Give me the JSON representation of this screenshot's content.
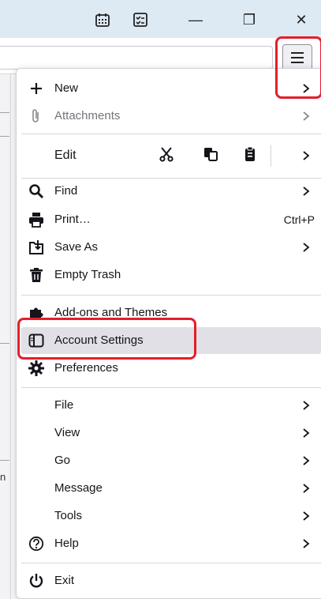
{
  "window": {
    "minimize_glyph": "—",
    "restore_glyph": "❐",
    "close_glyph": "✕",
    "icons": [
      "calendar-icon",
      "tasks-icon"
    ]
  },
  "background": {
    "partial_char": "n"
  },
  "colors": {
    "titlebar": "#dde9f3",
    "highlight": "#e41e2b",
    "hover": "#e0e0e6"
  },
  "menu": {
    "new": "New",
    "attachments": "Attachments",
    "edit": "Edit",
    "find": "Find",
    "print": "Print…",
    "print_shortcut": "Ctrl+P",
    "save_as": "Save As",
    "empty_trash": "Empty Trash",
    "addons": "Add-ons and Themes",
    "account_settings": "Account Settings",
    "preferences": "Preferences",
    "file": "File",
    "view": "View",
    "go": "Go",
    "message": "Message",
    "tools": "Tools",
    "help": "Help",
    "exit": "Exit",
    "highlighted_item": "Account Settings"
  }
}
